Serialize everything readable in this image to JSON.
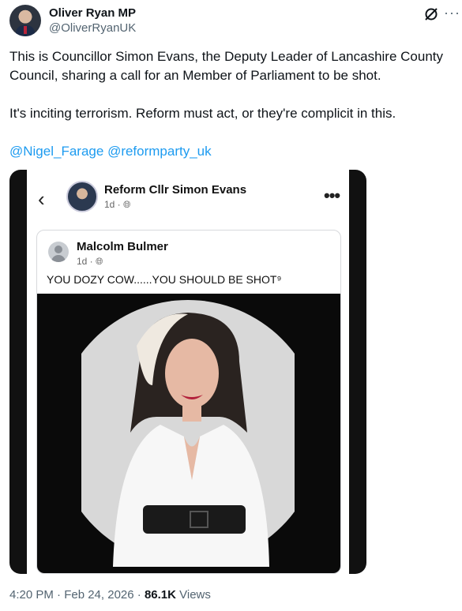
{
  "author": {
    "name": "Oliver Ryan MP",
    "handle": "@OliverRyanUK"
  },
  "header_icons": [
    "grok-icon",
    "more-icon"
  ],
  "tweet": {
    "paragraph1": "This is Councillor Simon Evans, the Deputy Leader of Lancashire County Council, sharing a call for an Member of Parliament to be shot.",
    "paragraph2": "It's inciting terrorism. Reform must act, or they're complicit in this.",
    "mention1": "@Nigel_Farage",
    "mention2": "@reformparty_uk"
  },
  "embedded_post": {
    "poster_name": "Reform Cllr Simon Evans",
    "poster_time": "1d · ",
    "shared": {
      "name": "Malcolm Bulmer",
      "time": "1d · ",
      "text": "YOU DOZY COW......YOU SHOULD BE SHOT⁹"
    }
  },
  "footer": {
    "time": "4:20 PM · Feb 24, 2026 · ",
    "views_count": "86.1K",
    "views_label": " Views"
  },
  "colors": {
    "link": "#1d9bf0",
    "secondary_text": "#536471",
    "primary_text": "#0f1419"
  }
}
